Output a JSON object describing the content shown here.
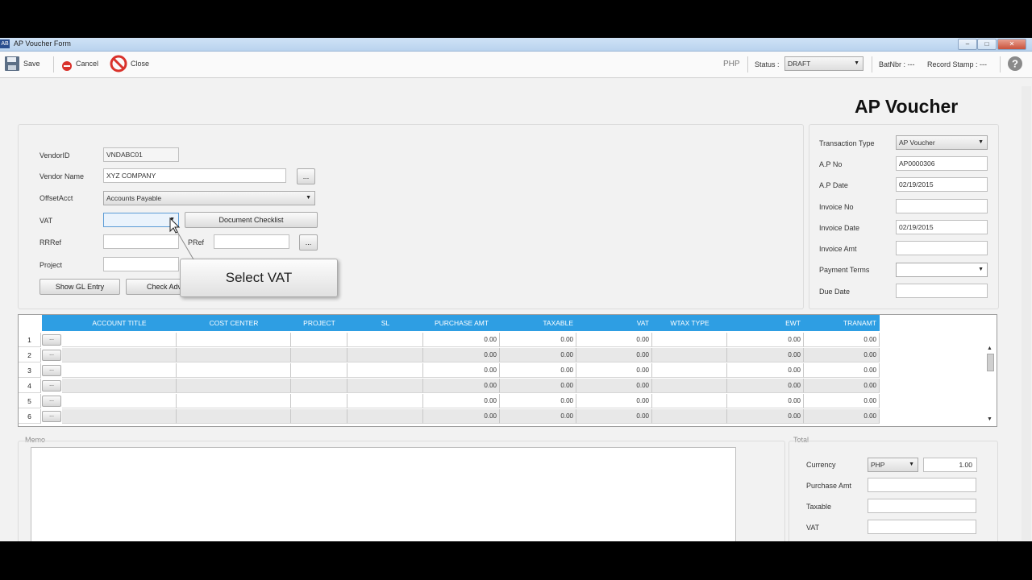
{
  "window": {
    "title": "AP Voucher Form",
    "app_icon": "AB",
    "btn_min": "–",
    "btn_max": "□",
    "btn_close": "✕"
  },
  "toolbar": {
    "save": "Save",
    "cancel": "Cancel",
    "close": "Close",
    "currency": "PHP",
    "status_label": "Status :",
    "status_value": "DRAFT",
    "batch": "BatNbr : ---",
    "record_stamp": "Record Stamp : ---"
  },
  "page_title": "AP Voucher",
  "vendor_form": {
    "vendor_id_label": "VendorID",
    "vendor_id": "VNDABC01",
    "vendor_name_label": "Vendor Name",
    "vendor_name": "XYZ COMPANY",
    "offset_label": "OffsetAcct",
    "offset_value": "Accounts Payable",
    "vat_label": "VAT",
    "vat_value": "",
    "doc_checklist": "Document Checklist",
    "rrref_label": "RRRef",
    "rrref_value": "",
    "prref_label": "PRef",
    "prref_value": "",
    "project_label": "Project",
    "project_value": "",
    "show_gl": "Show GL Entry",
    "check_adv": "Check Adva",
    "browse": "..."
  },
  "header_form": {
    "txn_type_label": "Transaction Type",
    "txn_type": "AP Voucher",
    "ap_no_label": "A.P No",
    "ap_no": "AP0000306",
    "ap_date_label": "A.P Date",
    "ap_date": "02/19/2015",
    "invoice_no_label": "Invoice No",
    "invoice_no": "",
    "invoice_date_label": "Invoice Date",
    "invoice_date": "02/19/2015",
    "invoice_amt_label": "Invoice Amt",
    "invoice_amt": "",
    "payment_terms_label": "Payment Terms",
    "payment_terms": "",
    "due_date_label": "Due Date",
    "due_date": ""
  },
  "tooltip": "Select VAT",
  "grid": {
    "columns": [
      "ACCOUNT TITLE",
      "COST CENTER",
      "PROJECT",
      "SL",
      "PURCHASE AMT",
      "TAXABLE",
      "VAT",
      "WTAX TYPE",
      "EWT",
      "TRANAMT"
    ],
    "rows": [
      {
        "num": "1",
        "btn": "...",
        "purchase_amt": "0.00",
        "taxable": "0.00",
        "vat": "0.00",
        "ewt": "0.00",
        "tranamt": "0.00"
      },
      {
        "num": "2",
        "btn": "...",
        "purchase_amt": "0.00",
        "taxable": "0.00",
        "vat": "0.00",
        "ewt": "0.00",
        "tranamt": "0.00"
      },
      {
        "num": "3",
        "btn": "...",
        "purchase_amt": "0.00",
        "taxable": "0.00",
        "vat": "0.00",
        "ewt": "0.00",
        "tranamt": "0.00"
      },
      {
        "num": "4",
        "btn": "...",
        "purchase_amt": "0.00",
        "taxable": "0.00",
        "vat": "0.00",
        "ewt": "0.00",
        "tranamt": "0.00"
      },
      {
        "num": "5",
        "btn": "...",
        "purchase_amt": "0.00",
        "taxable": "0.00",
        "vat": "0.00",
        "ewt": "0.00",
        "tranamt": "0.00"
      },
      {
        "num": "6",
        "btn": "...",
        "purchase_amt": "0.00",
        "taxable": "0.00",
        "vat": "0.00",
        "ewt": "0.00",
        "tranamt": "0.00"
      }
    ]
  },
  "memo": {
    "label": "Memo",
    "value": ""
  },
  "totals": {
    "label": "Total",
    "currency_label": "Currency",
    "currency": "PHP",
    "rate": "1.00",
    "purchase_amt_label": "Purchase Amt",
    "purchase_amt": "",
    "taxable_label": "Taxable",
    "taxable": "",
    "vat_label": "VAT",
    "vat": ""
  },
  "colors": {
    "accent": "#2e9ee3",
    "window_bg": "#f2f2f2",
    "grid_alt": "#e8e8e8"
  }
}
